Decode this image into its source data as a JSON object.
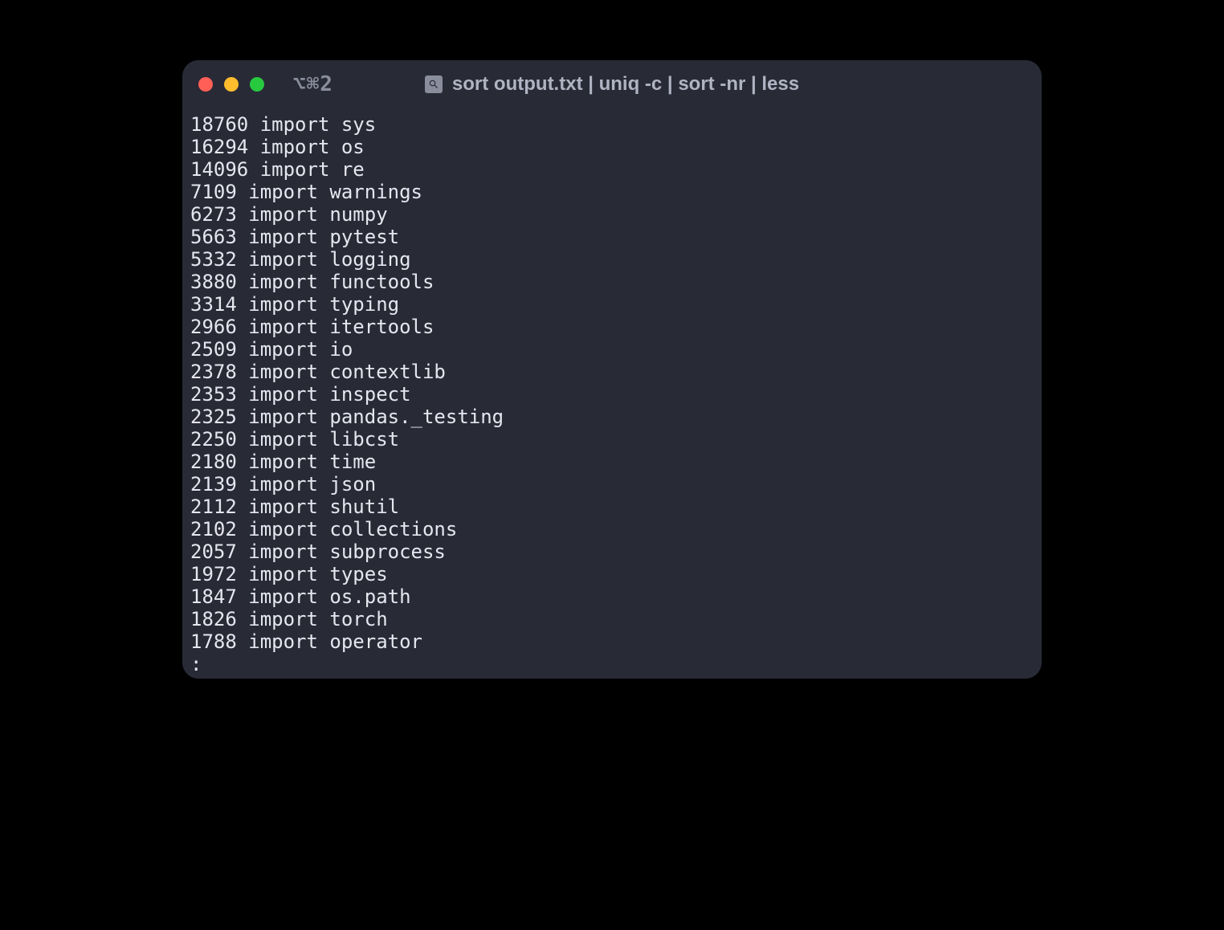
{
  "titlebar": {
    "shortcut": "⌥⌘2",
    "title": "sort output.txt | uniq -c | sort -nr | less"
  },
  "output": {
    "lines": [
      "18760 import sys",
      "16294 import os",
      "14096 import re",
      "7109 import warnings",
      "6273 import numpy",
      "5663 import pytest",
      "5332 import logging",
      "3880 import functools",
      "3314 import typing",
      "2966 import itertools",
      "2509 import io",
      "2378 import contextlib",
      "2353 import inspect",
      "2325 import pandas._testing",
      "2250 import libcst",
      "2180 import time",
      "2139 import json",
      "2112 import shutil",
      "2102 import collections",
      "2057 import subprocess",
      "1972 import types",
      "1847 import os.path",
      "1826 import torch",
      "1788 import operator"
    ],
    "prompt": ":"
  }
}
